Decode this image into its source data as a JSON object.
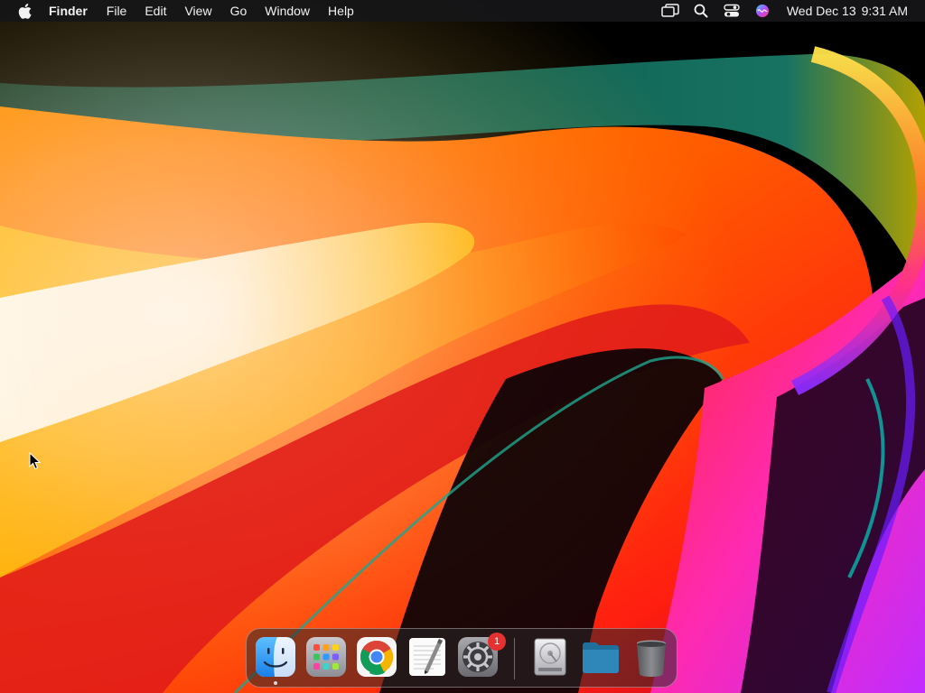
{
  "menubar": {
    "apple_icon": "apple-logo-icon",
    "app_name": "Finder",
    "menus": [
      "File",
      "Edit",
      "View",
      "Go",
      "Window",
      "Help"
    ],
    "status_icons": [
      "screen-mirroring-icon",
      "spotlight-search-icon",
      "control-center-icon",
      "siri-icon"
    ],
    "clock": {
      "date": "Wed Dec 13",
      "time": "9:31 AM"
    }
  },
  "dock": {
    "apps": [
      {
        "name": "Finder",
        "icon": "finder-icon",
        "running": true
      },
      {
        "name": "Launchpad",
        "icon": "launchpad-icon",
        "running": false
      },
      {
        "name": "Google Chrome",
        "icon": "chrome-icon",
        "running": false
      },
      {
        "name": "TextEdit",
        "icon": "textedit-icon",
        "running": false
      },
      {
        "name": "System Preferences",
        "icon": "system-preferences-icon",
        "running": false,
        "badge": "1"
      }
    ],
    "others": [
      {
        "name": "Macintosh HD",
        "icon": "hard-drive-icon"
      },
      {
        "name": "Folder",
        "icon": "folder-icon"
      },
      {
        "name": "Trash",
        "icon": "trash-icon"
      }
    ]
  },
  "colors": {
    "menubar_bg": "#161618",
    "badge": "#e5312f"
  }
}
